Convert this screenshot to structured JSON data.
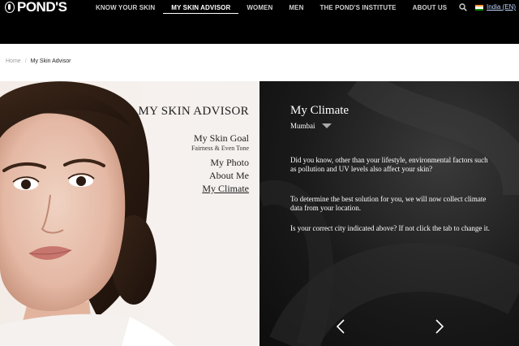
{
  "brand": {
    "logo_text": "POND'S"
  },
  "nav": {
    "items": [
      {
        "label": "KNOW YOUR SKIN"
      },
      {
        "label": "MY SKIN ADVISOR",
        "active": true
      },
      {
        "label": "WOMEN"
      },
      {
        "label": "MEN"
      },
      {
        "label": "THE POND'S INSTITUTE"
      },
      {
        "label": "ABOUT US"
      }
    ],
    "locale": "India (EN)"
  },
  "breadcrumb": {
    "home": "Home",
    "separator": "/",
    "current": "My Skin Advisor"
  },
  "advisor": {
    "title": "MY SKIN ADVISOR",
    "items": [
      {
        "label": "My Skin Goal",
        "sub": "Fairness & Even Tone"
      },
      {
        "label": "My Photo"
      },
      {
        "label": "About Me"
      },
      {
        "label": "My Climate",
        "active": true
      }
    ]
  },
  "climate": {
    "title": "My Climate",
    "city": "Mumbai",
    "paragraphs": [
      "Did you know, other than your lifestyle, environmental factors such as pollution and UV levels also affect your skin?",
      "To determine the best solution for you, we will now collect climate data from your location.",
      "Is your correct city indicated above? If not click the tab to change it."
    ],
    "icons": {
      "prev": "chevron-left-icon",
      "next": "chevron-right-icon",
      "city_dropdown": "caret-down-icon"
    }
  },
  "colors": {
    "nav_bg": "#000000",
    "panel_dark": "#1a1a1a",
    "accent_text": "#ffffff"
  }
}
